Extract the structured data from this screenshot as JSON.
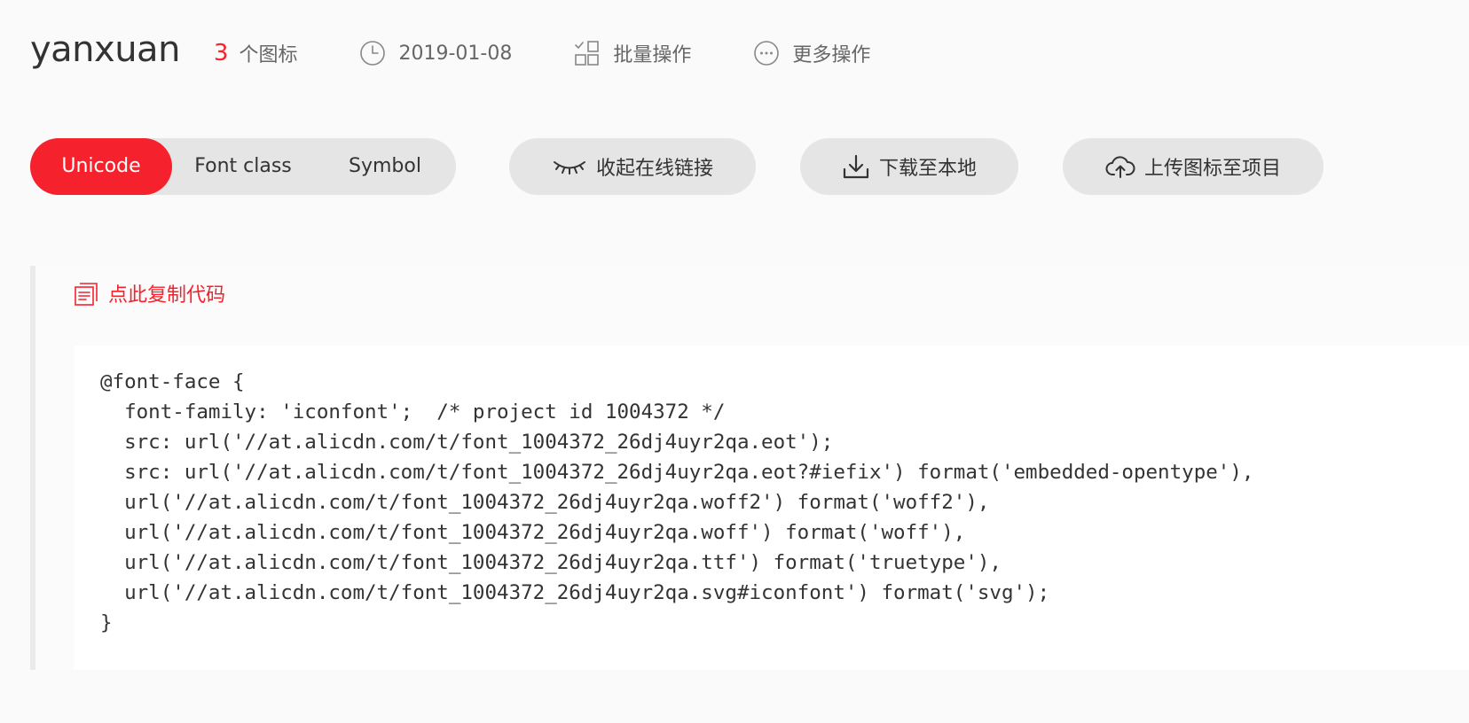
{
  "header": {
    "project_name": "yanxuan",
    "icon_count": "3",
    "icon_count_label": "个图标",
    "date": "2019-01-08",
    "batch_ops_label": "批量操作",
    "more_ops_label": "更多操作"
  },
  "toolbar": {
    "tabs": [
      {
        "label": "Unicode",
        "active": true
      },
      {
        "label": "Font class",
        "active": false
      },
      {
        "label": "Symbol",
        "active": false
      }
    ],
    "collapse_link_label": "收起在线链接",
    "download_label": "下载至本地",
    "upload_label": "上传图标至项目"
  },
  "code_panel": {
    "copy_label": "点此复制代码",
    "code_lines": [
      "@font-face {",
      "  font-family: 'iconfont';  /* project id 1004372 */",
      "  src: url('//at.alicdn.com/t/font_1004372_26dj4uyr2qa.eot');",
      "  src: url('//at.alicdn.com/t/font_1004372_26dj4uyr2qa.eot?#iefix') format('embedded-opentype'),",
      "  url('//at.alicdn.com/t/font_1004372_26dj4uyr2qa.woff2') format('woff2'),",
      "  url('//at.alicdn.com/t/font_1004372_26dj4uyr2qa.woff') format('woff'),",
      "  url('//at.alicdn.com/t/font_1004372_26dj4uyr2qa.ttf') format('truetype'),",
      "  url('//at.alicdn.com/t/font_1004372_26dj4uyr2qa.svg#iconfont') format('svg');",
      "}"
    ]
  },
  "colors": {
    "accent": "#f5222d",
    "pill_bg": "#e5e5e5",
    "page_bg": "#fafafa"
  },
  "icons": {
    "clock": "clock-icon",
    "batch": "grid-check-icon",
    "more": "more-dots-icon",
    "collapse": "closed-eye-icon",
    "download": "download-icon",
    "upload": "cloud-upload-icon",
    "copy": "copy-icon"
  }
}
